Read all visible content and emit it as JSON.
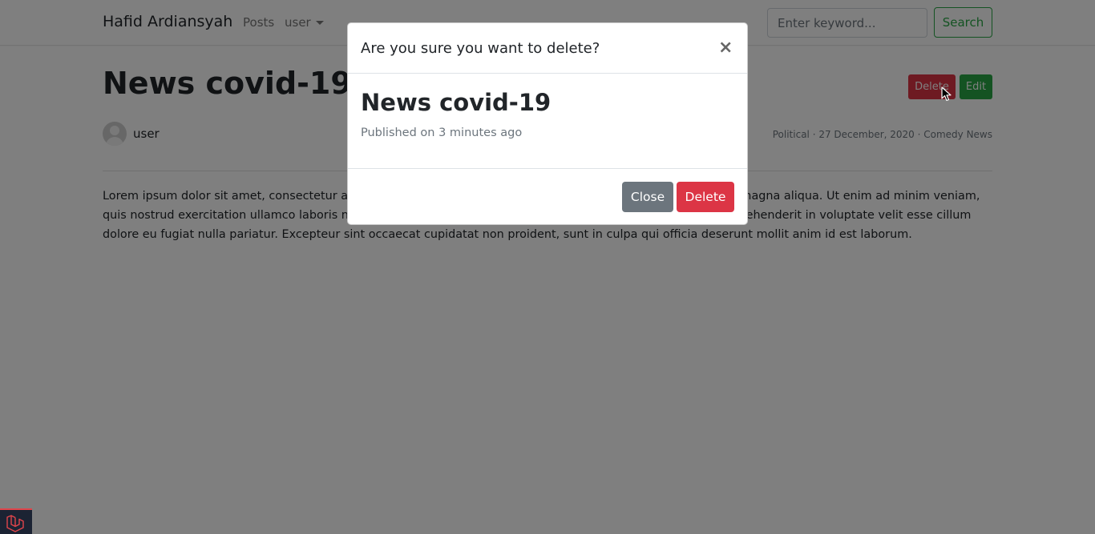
{
  "navbar": {
    "brand": "Hafid Ardiansyah",
    "links": [
      {
        "label": "Posts"
      },
      {
        "label": "user"
      }
    ],
    "search": {
      "placeholder": "Enter keyword...",
      "button_label": "Search"
    }
  },
  "post": {
    "title": "News covid-19",
    "actions": {
      "delete_label": "Delete",
      "edit_label": "Edit"
    },
    "author": "user",
    "meta": "Political · 27 December, 2020 · Comedy News",
    "body": "Lorem ipsum dolor sit amet, consectetur adipiscing elit, sed do eiusmod tempor incididunt ut labore et dolore magna aliqua. Ut enim ad minim veniam, quis nostrud exercitation ullamco laboris nisi ut aliquip ex ea commodo consequat. Duis aute irure dolor in reprehenderit in voluptate velit esse cillum dolore eu fugiat nulla pariatur. Excepteur sint occaecat cupidatat non proident, sunt in culpa qui officia deserunt mollit anim id est laborum."
  },
  "modal": {
    "title": "Are you sure you want to delete?",
    "close_icon": "×",
    "post_title": "News covid-19",
    "published": "Published on 3 minutes ago",
    "close_label": "Close",
    "delete_label": "Delete"
  },
  "colors": {
    "danger": "#dc3545",
    "success": "#28a745",
    "secondary": "#6c757d",
    "backdrop": "rgba(0,0,0,0.5)"
  },
  "icons": [
    "user-avatar-icon",
    "caret-down-icon",
    "close-icon",
    "mouse-cursor-icon",
    "laravel-logo-icon"
  ]
}
